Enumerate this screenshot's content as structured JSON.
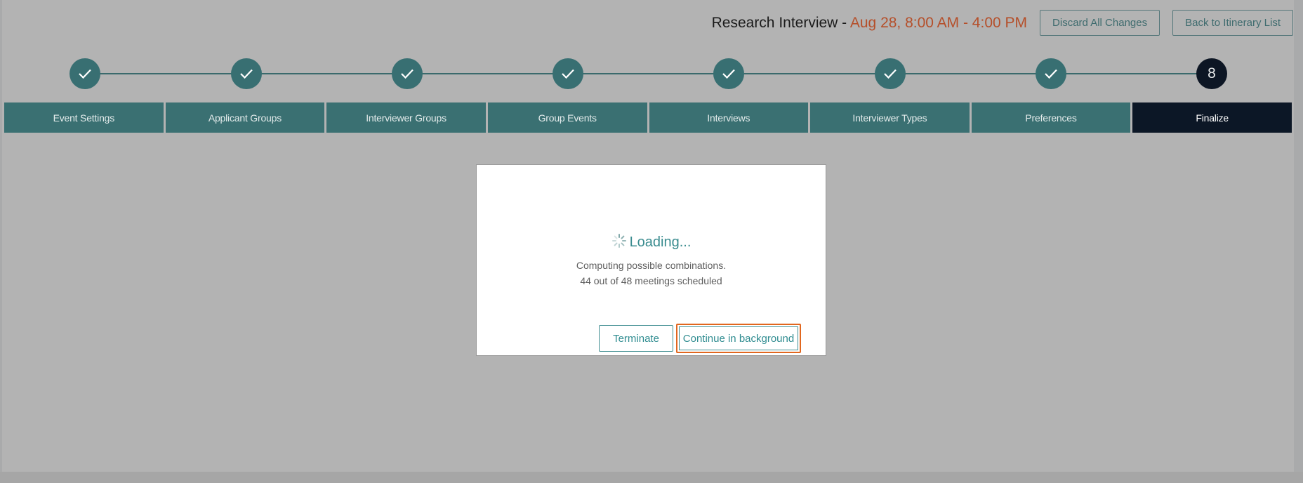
{
  "header": {
    "title": "Research Interview -",
    "date_range": "Aug 28, 8:00 AM - 4:00 PM",
    "discard_label": "Discard All Changes",
    "back_label": "Back to Itinerary List"
  },
  "stepper": {
    "final_step_number": "8",
    "completed_icon": "check-icon"
  },
  "tabs": [
    {
      "label": "Event Settings"
    },
    {
      "label": "Applicant Groups"
    },
    {
      "label": "Interviewer Groups"
    },
    {
      "label": "Group Events"
    },
    {
      "label": "Interviews"
    },
    {
      "label": "Interviewer Types"
    },
    {
      "label": "Preferences"
    },
    {
      "label": "Finalize"
    }
  ],
  "modal": {
    "loading_text": "Loading...",
    "line1": "Computing possible combinations.",
    "line2": "44 out of 48 meetings scheduled",
    "terminate_label": "Terminate",
    "continue_label": "Continue in background"
  },
  "colors": {
    "accent": "#3a7072",
    "active_tab": "#0c1726",
    "date": "#b54f2a",
    "focus_outline": "#e1671f"
  }
}
